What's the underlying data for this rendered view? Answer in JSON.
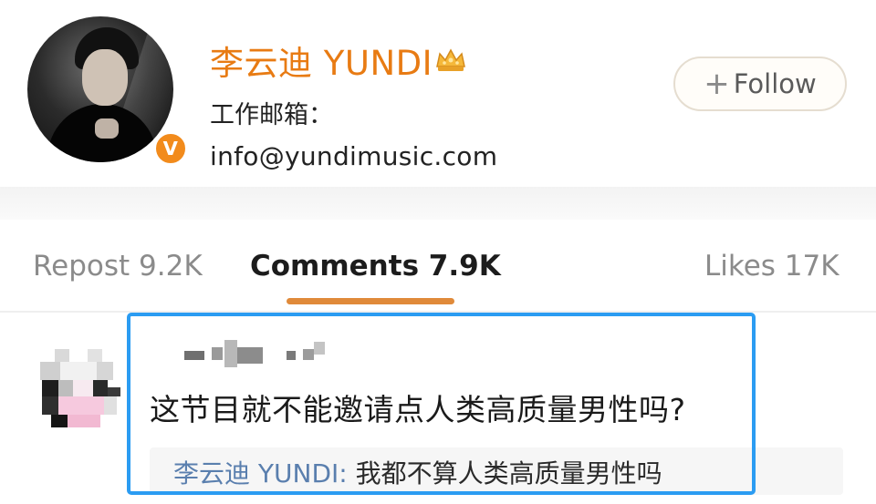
{
  "profile": {
    "name": "李云迪 YUNDI",
    "bio_label": "工作邮箱：",
    "bio_email": "info@yundimusic.com",
    "verify_badge": "V",
    "follow_plus": "+",
    "follow_label": "Follow",
    "avatar_icon": "user-photo",
    "crown_icon": "crown-icon",
    "name_color": "#e87b13"
  },
  "tabs": [
    {
      "label": "Repost 9.2K",
      "active": false
    },
    {
      "label": "Comments 7.9K",
      "active": true
    },
    {
      "label": "Likes 17K",
      "active": false
    }
  ],
  "comment": {
    "text": "这节目就不能邀请点人类高质量男性吗?",
    "reply_author": "李云迪 YUNDI:",
    "reply_content": " 我都不算人类高质量男性吗"
  },
  "colors": {
    "accent": "#e08a3a",
    "highlight_border": "#2b9cf2",
    "reply_author": "#5a7fae"
  }
}
